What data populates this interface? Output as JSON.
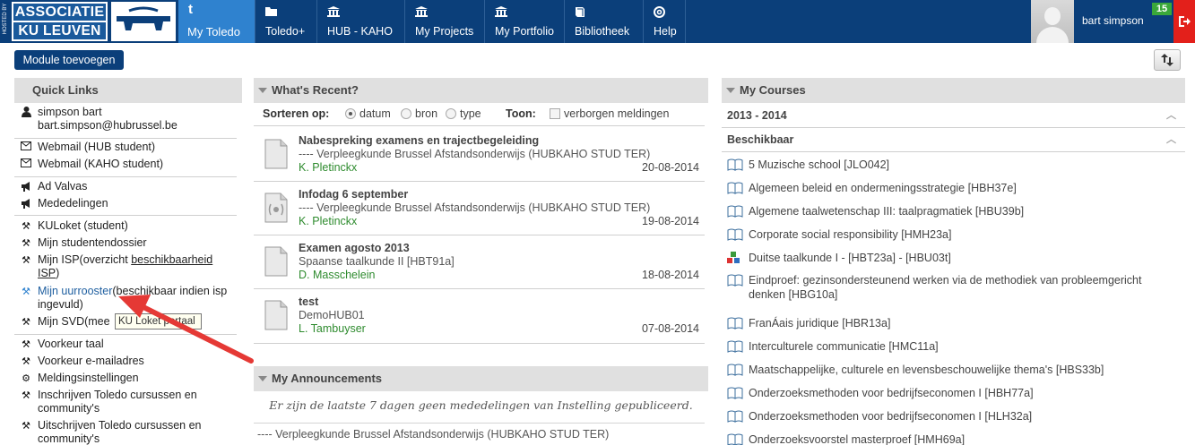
{
  "brand": {
    "hosted_by": "HOSTED BY",
    "logo_line1": "ASSOCIATIE",
    "logo_line2": "KU LEUVEN"
  },
  "nav": {
    "items": [
      {
        "label": "My Toledo",
        "icon": "toledo-t-icon",
        "active": true
      },
      {
        "label": "Toledo+",
        "icon": "folder-icon"
      },
      {
        "label": "HUB - KAHO",
        "icon": "institution-icon"
      },
      {
        "label": "My Projects",
        "icon": "institution-icon"
      },
      {
        "label": "My Portfolio",
        "icon": "institution-icon"
      },
      {
        "label": "Bibliotheek",
        "icon": "book-icon"
      },
      {
        "label": "Help",
        "icon": "lifebuoy-icon"
      }
    ],
    "user_name": "bart simpson",
    "notification_count": "15",
    "active_color": "#2f82cf",
    "bar_color": "#0b3f7a",
    "logout_color": "#e3201b"
  },
  "toolbar": {
    "add_module_label": "Module toevoegen"
  },
  "quick_links": {
    "title": "Quick Links",
    "profile_name": "simpson bart",
    "profile_email": "bart.simpson@hubrussel.be",
    "webmail_hub": "Webmail (HUB student)",
    "webmail_kaho": "Webmail (KAHO student)",
    "ad_valvas": "Ad Valvas",
    "mededelingen": "Mededelingen",
    "kuloket": "KULoket (student)",
    "studentendossier": "Mijn studentendossier",
    "isp_prefix": "Mijn ISP(overzicht ",
    "isp_link": "beschikbaarheid",
    "isp_line2": "ISP",
    "isp_suffix": ")",
    "uurrooster_link": "Mijn uurrooster",
    "uurrooster_suffix": "(beschikbaar indien isp ingevuld)",
    "svd": "Mijn SVD(mee",
    "tooltip": "KU Loket portaal",
    "voorkeur_taal": "Voorkeur taal",
    "voorkeur_email": "Voorkeur e-mailadres",
    "meldingsinstellingen": "Meldingsinstellingen",
    "inschrijven": "Inschrijven Toledo cursussen en community's",
    "uitschrijven": "Uitschrijven Toledo cursussen en community's"
  },
  "recent": {
    "title": "What's Recent?",
    "sort_label": "Sorteren op:",
    "sort_options": [
      "datum",
      "bron",
      "type"
    ],
    "sort_selected": "datum",
    "show_label": "Toon:",
    "hidden_label": "verborgen meldingen",
    "items": [
      {
        "title": "Nabespreking examens en trajectbegeleiding",
        "sub": "---- Verpleegkunde Brussel Afstandsonderwijs (HUBKAHO STUD TER)",
        "author": "K. Pletinckx",
        "date": "20-08-2014",
        "icon": "document-icon"
      },
      {
        "title": "Infodag 6 september",
        "sub": "---- Verpleegkunde Brussel Afstandsonderwijs (HUBKAHO STUD TER)",
        "author": "K. Pletinckx",
        "date": "19-08-2014",
        "icon": "announcement-document-icon"
      },
      {
        "title": "Examen agosto 2013",
        "sub": "Spaanse taalkunde II [HBT91a]",
        "author": "D. Masschelein",
        "date": "18-08-2014",
        "icon": "document-icon"
      },
      {
        "title": "test",
        "sub": "DemoHUB01",
        "author": "L. Tambuyser",
        "date": "07-08-2014",
        "icon": "document-icon"
      }
    ]
  },
  "announcements": {
    "title": "My Announcements",
    "empty_text": "Er zijn de laatste 7 dagen geen mededelingen van Instelling gepubliceerd.",
    "course_line": "---- Verpleegkunde Brussel Afstandsonderwijs (HUBKAHO STUD TER)"
  },
  "courses": {
    "title": "My Courses",
    "year": "2013 - 2014",
    "group": "Beschikbaar",
    "items": [
      {
        "label": "5 Muzische school [JLO042]",
        "icon": "book-icon"
      },
      {
        "label": "Algemeen beleid en ondermeningsstrategie [HBH37e]",
        "icon": "book-icon"
      },
      {
        "label": "Algemene taalwetenschap III: taalpragmatiek [HBU39b]",
        "icon": "book-icon"
      },
      {
        "label": "Corporate social responsibility [HMH23a]",
        "icon": "book-icon"
      },
      {
        "label": "Duitse taalkunde I - [HBT23a] - [HBU03t]",
        "icon": "blocks-icon"
      },
      {
        "label": "Eindproef: gezinsondersteunend werken via de methodiek van probleemgericht denken [HBG10a]",
        "icon": "book-icon"
      },
      {
        "label": "FranÁais juridique [HBR13a]",
        "icon": "book-icon"
      },
      {
        "label": "Interculturele communicatie [HMC11a]",
        "icon": "book-icon"
      },
      {
        "label": "Maatschappelijke, culturele en levensbeschouwelijke thema's [HBS33b]",
        "icon": "book-icon"
      },
      {
        "label": "Onderzoeksmethoden voor bedrijfseconomen I [HBH77a]",
        "icon": "book-icon"
      },
      {
        "label": "Onderzoeksmethoden voor bedrijfseconomen I [HLH32a]",
        "icon": "book-icon"
      },
      {
        "label": "Onderzoeksvoorstel masterproef [HMH69a]",
        "icon": "book-icon"
      }
    ]
  }
}
